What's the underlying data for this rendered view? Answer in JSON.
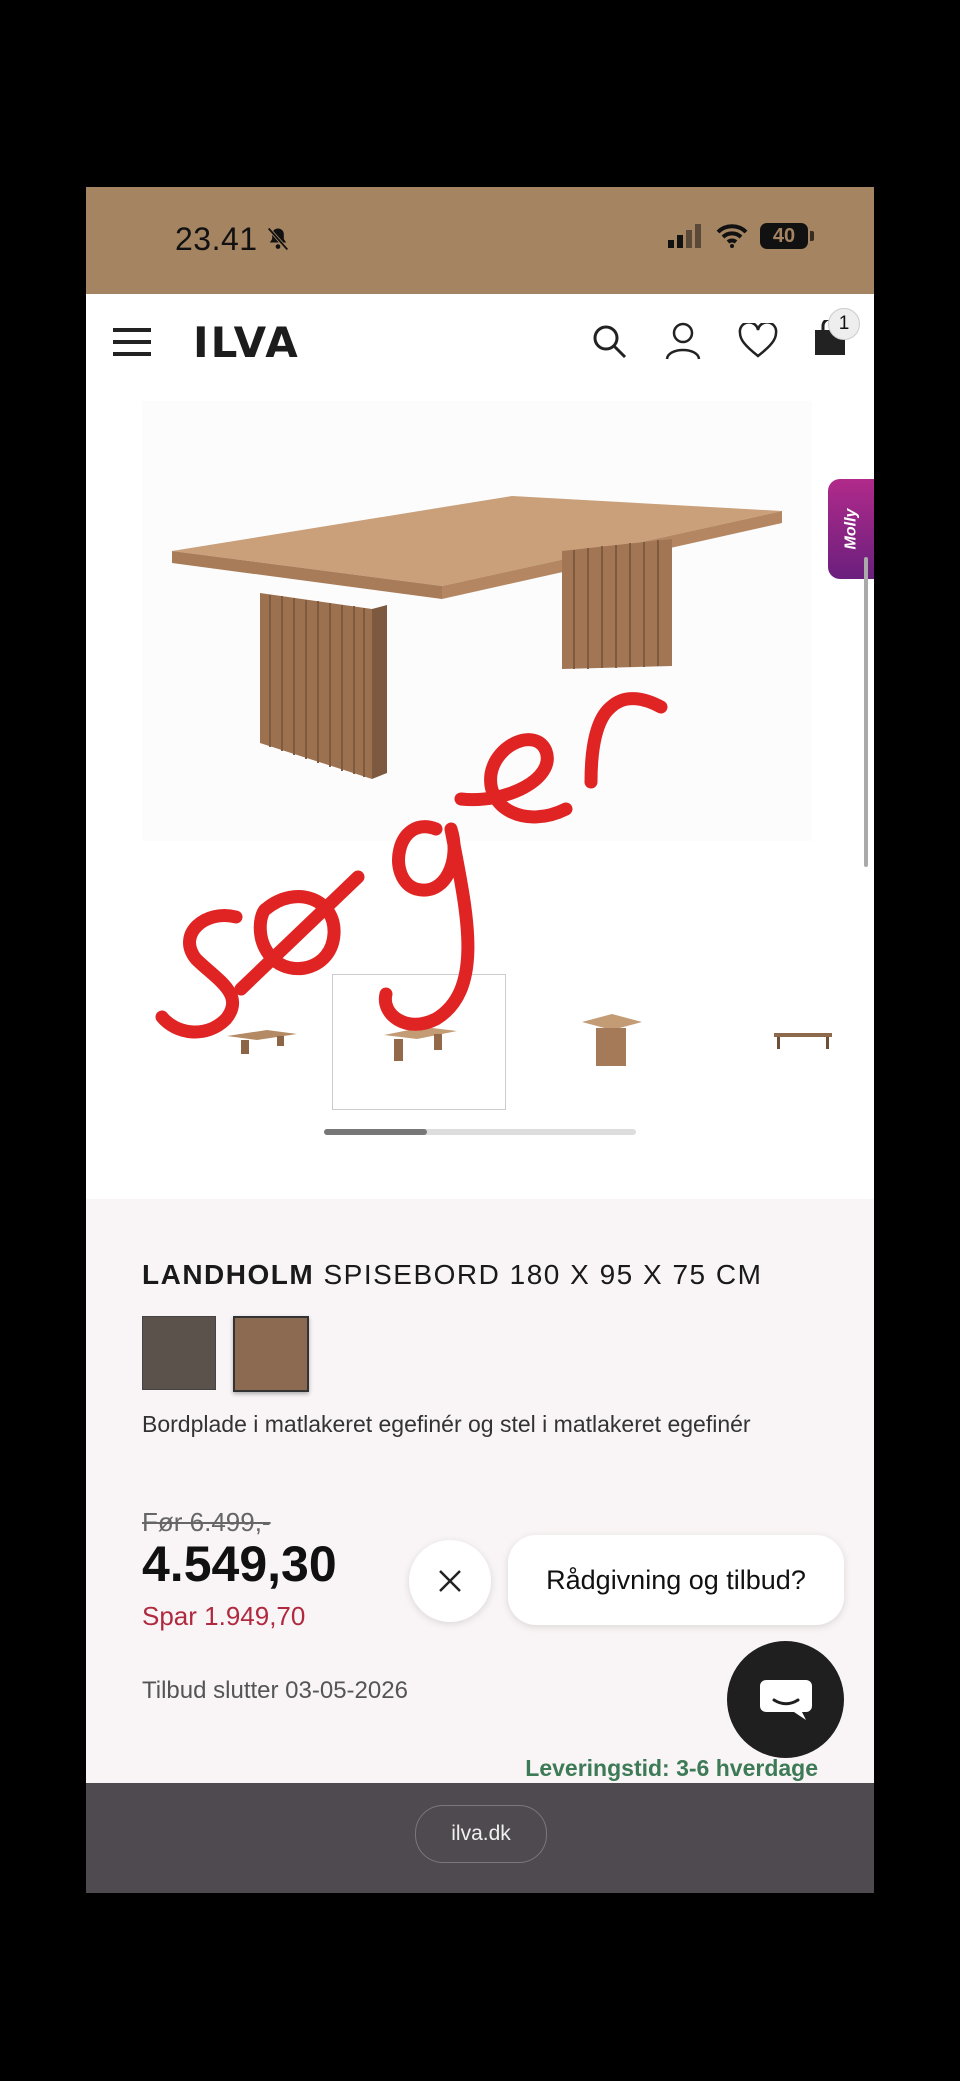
{
  "status": {
    "time": "23.41",
    "battery": "40"
  },
  "header": {
    "logo": "ILVA",
    "cart_count": "1"
  },
  "molly_tab": "Molly",
  "product": {
    "brand": "LANDHOLM",
    "name": "SPISEBORD 180 X 95 X 75 CM",
    "description": "Bordplade i matlakeret egefinér og stel i matlakeret egefinér",
    "old_price": "Før 6.499,-",
    "price": "4.549,30",
    "savings": "Spar 1.949,70",
    "offer_ends": "Tilbud slutter 03-05-2026",
    "delivery": "Leveringstid: 3-6 hverdage",
    "swatch_colors": [
      "#5c524c",
      "#8c6a52"
    ]
  },
  "gallery": {
    "progress": 0.33
  },
  "chat": {
    "prompt": "Rådgivning og tilbud?"
  },
  "browser": {
    "url": "ilva.dk"
  },
  "annotation_text": "søger"
}
